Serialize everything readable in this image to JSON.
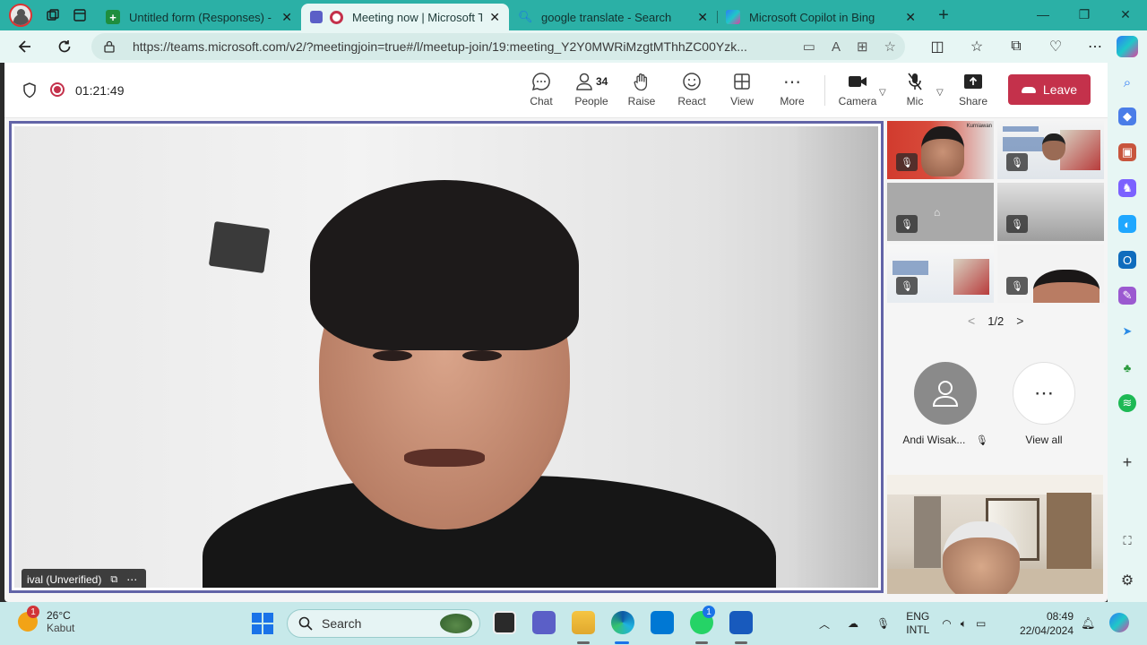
{
  "browser": {
    "tabs": [
      {
        "label": "Untitled form (Responses) - Goo",
        "icon": "google-sheets-icon",
        "active": false,
        "color": "#1e8e3e"
      },
      {
        "label": "Meeting now | Microsoft Te",
        "icon": "teams-icon",
        "active": true,
        "color": "#5b5fc7"
      },
      {
        "label": "google translate - Search",
        "icon": "bing-search-icon",
        "active": false,
        "color": "#1a73e8"
      },
      {
        "label": "Microsoft Copilot in Bing",
        "icon": "copilot-icon",
        "active": false,
        "color": "#2e7bf6"
      }
    ],
    "url": "https://teams.microsoft.com/v2/?meetingjoin=true#/l/meetup-join/19:meeting_Y2Y0MWRiMzgtMThhZC00Yzk..."
  },
  "meeting": {
    "timer": "01:21:49",
    "controls": {
      "chat": "Chat",
      "people": "People",
      "people_count": "34",
      "raise": "Raise",
      "react": "React",
      "view": "View",
      "more": "More",
      "camera": "Camera",
      "mic": "Mic",
      "share": "Share",
      "leave": "Leave"
    },
    "main_speaker": {
      "name": "ival (Unverified)"
    },
    "gallery": {
      "pager": "1/2",
      "tile_caption": "Kurniawan"
    },
    "participant": {
      "name": "Andi Wisak..."
    },
    "view_all": "View all"
  },
  "taskbar": {
    "weather_temp": "26°C",
    "weather_cond": "Kabut",
    "weather_badge": "1",
    "search_placeholder": "Search",
    "whatsapp_badge": "1",
    "lang_top": "ENG",
    "lang_bottom": "INTL",
    "time": "08:49",
    "date": "22/04/2024"
  }
}
